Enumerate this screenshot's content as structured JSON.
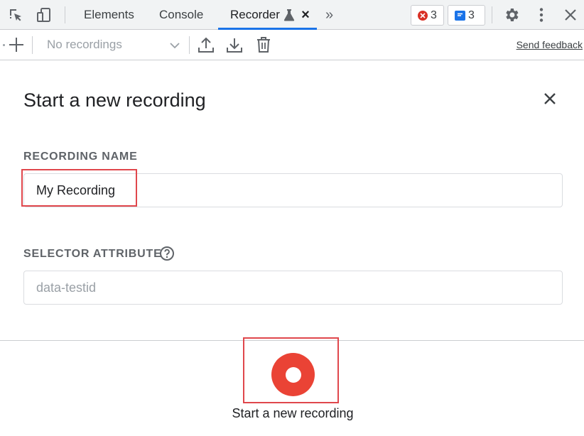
{
  "tabbar": {
    "tabs": [
      {
        "label": "Elements"
      },
      {
        "label": "Console"
      },
      {
        "label": "Recorder"
      }
    ],
    "more_tabs_glyph": "»",
    "close_glyph": "×",
    "errors_count": "3",
    "messages_count": "3",
    "colors": {
      "accent": "#1a73e8",
      "error": "#d93025",
      "message": "#1a73e8"
    }
  },
  "toolbar": {
    "recordings_select": "No recordings",
    "send_feedback": "Send feedback"
  },
  "dialog": {
    "title": "Start a new recording",
    "recording_name_label": "RECORDING NAME",
    "recording_name_value": "My Recording",
    "selector_attribute_label": "SELECTOR ATTRIBUTE",
    "selector_attribute_placeholder": "data-testid"
  },
  "footer": {
    "start_button_caption": "Start a new recording",
    "record_color": "#ea4335"
  }
}
